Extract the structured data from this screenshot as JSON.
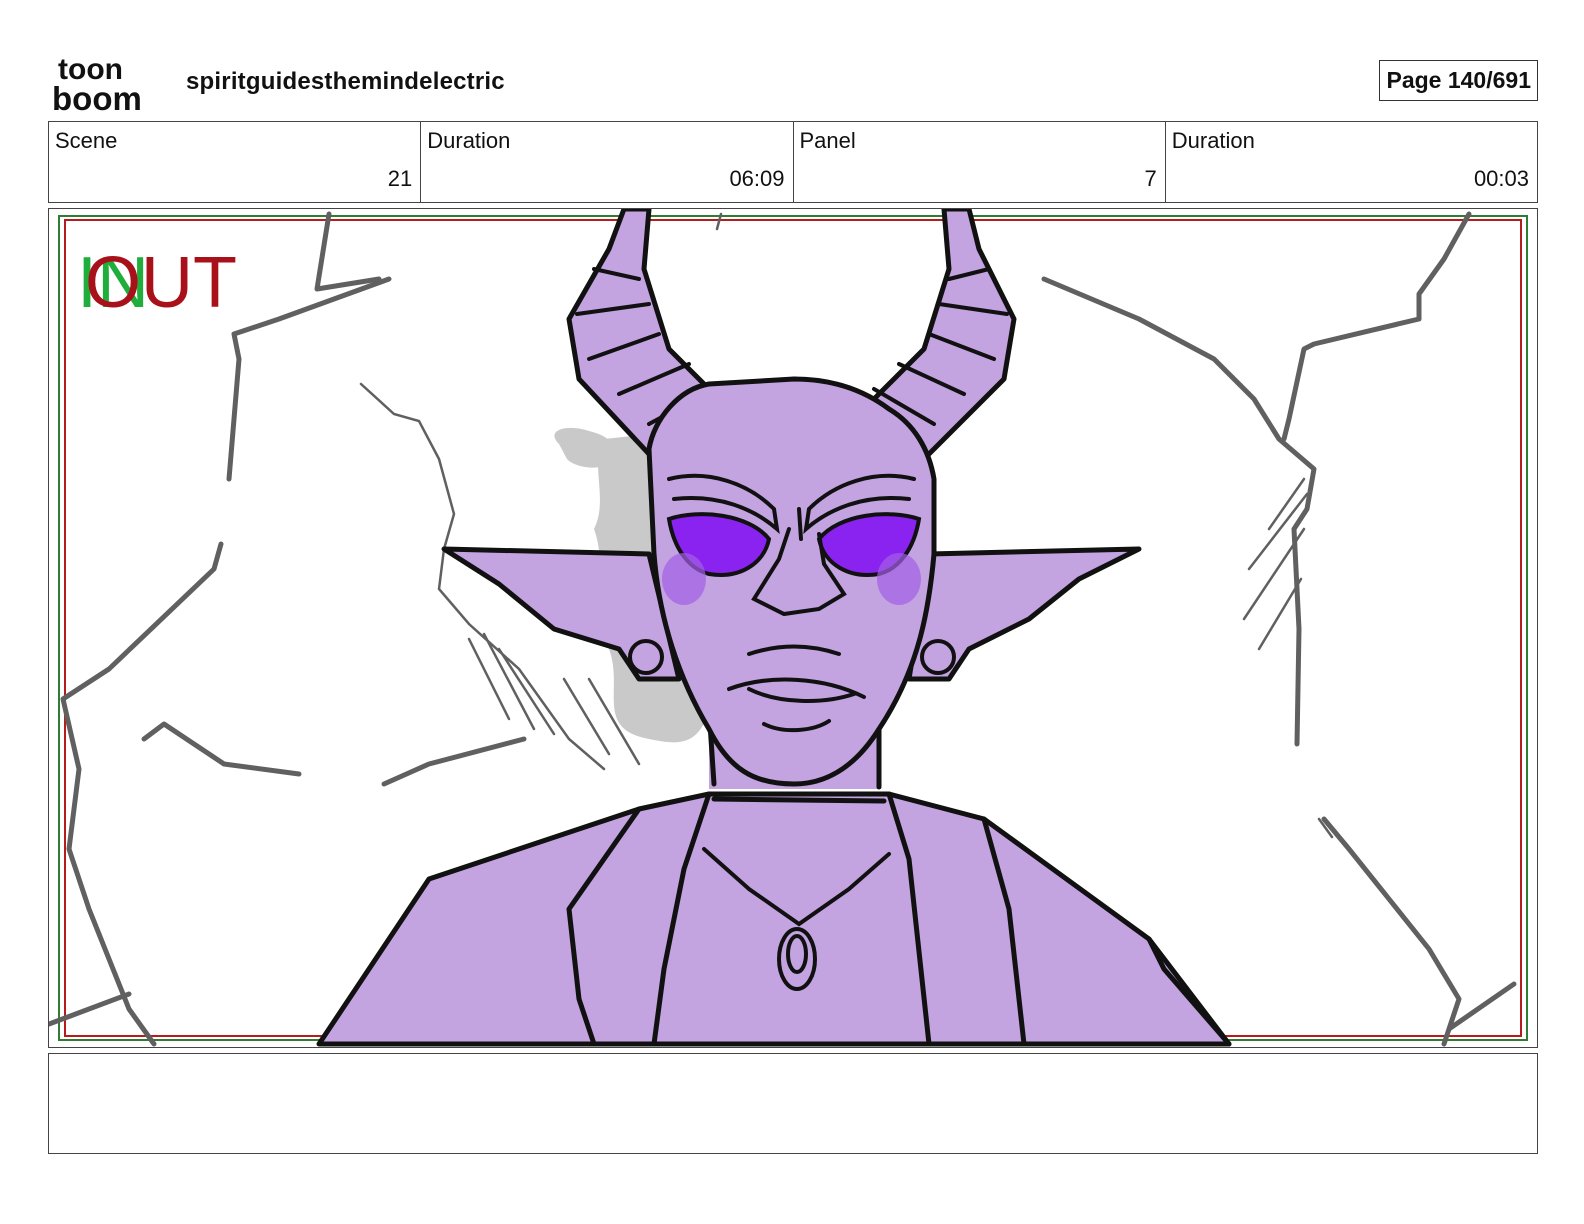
{
  "header": {
    "logo_line1": "toon",
    "logo_line2": "boom",
    "project_title": "spiritguidesthemindelectric",
    "page_indicator": "Page 140/691"
  },
  "info": [
    {
      "label": "Scene",
      "value": "21"
    },
    {
      "label": "Duration",
      "value": "06:09"
    },
    {
      "label": "Panel",
      "value": "7"
    },
    {
      "label": "Duration",
      "value": "00:03"
    }
  ],
  "panel": {
    "in_label": "IN",
    "out_label": "OUT",
    "colors": {
      "in_marker": "#1fae3b",
      "out_marker": "#a8111a",
      "skin": "#c3a3e0",
      "eyes": "#8a22f0",
      "shadow": "#c9c9c9",
      "rock_lines": "#606060",
      "line_art": "#111111"
    }
  },
  "notes": {
    "text": ""
  }
}
